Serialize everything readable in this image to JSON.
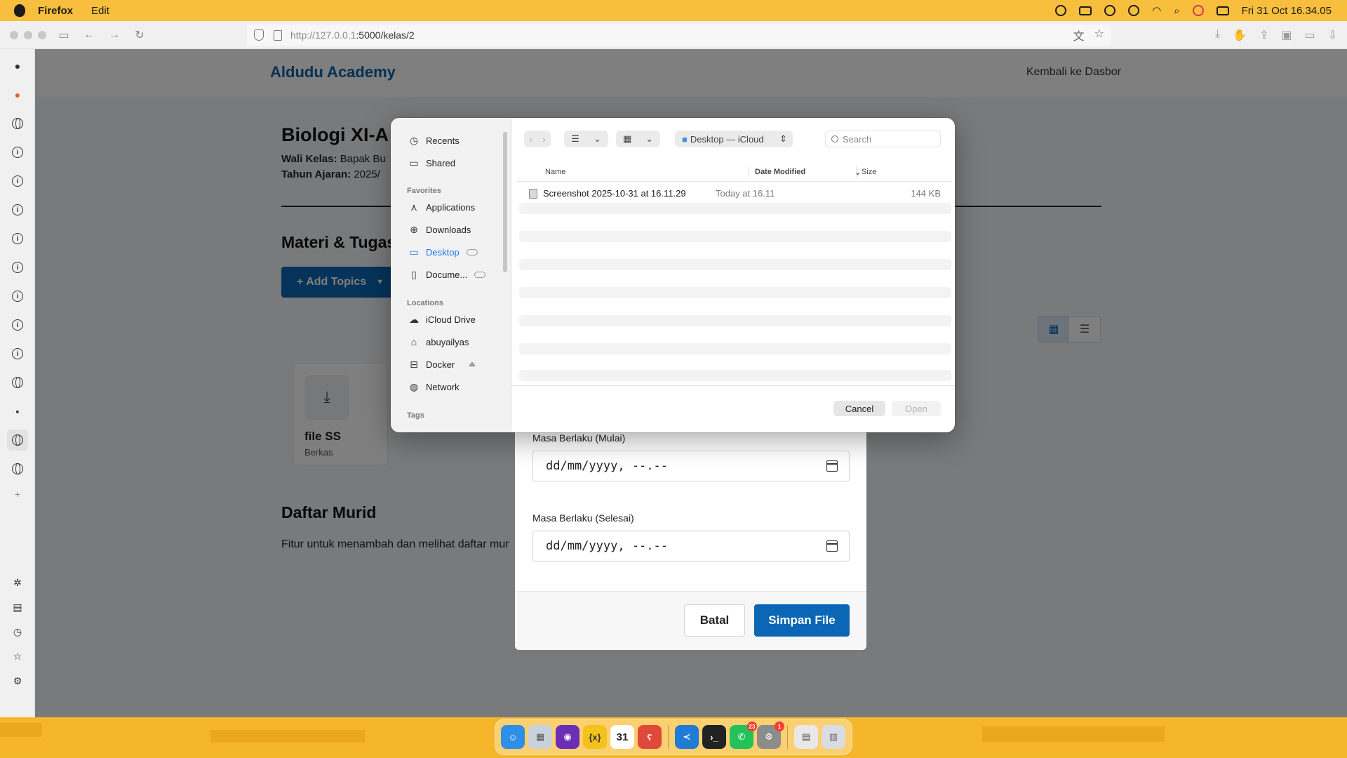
{
  "menubar": {
    "app_name": "Firefox",
    "menu_items": [
      "Edit"
    ],
    "datetime": "Fri 31 Oct  16.34.05"
  },
  "browser": {
    "url_host": "http://127.0.0.1",
    "url_path": ":5000/kelas/2"
  },
  "site": {
    "brand": "Aldudu Academy",
    "back_link": "Kembali ke Dasbor"
  },
  "course": {
    "title": "Biologi XI-A",
    "wali_label": "Wali Kelas:",
    "wali_value": "Bapak Bu",
    "tahun_label": "Tahun Ajaran:",
    "tahun_value": "2025/",
    "materials_title": "Materi & Tugas",
    "add_topics_label": "+ Add Topics",
    "file_card_name": "file SS",
    "file_card_type": "Berkas",
    "students_title": "Daftar Murid",
    "students_text": "Fitur untuk menambah dan melihat daftar mur"
  },
  "modal": {
    "start_label": "Masa Berlaku (Mulai)",
    "start_value": "dd/mm/yyyy, --.--",
    "end_label": "Masa Berlaku (Selesai)",
    "end_value": "dd/mm/yyyy, --.--",
    "cancel_label": "Batal",
    "save_label": "Simpan File"
  },
  "picker": {
    "sidebar": {
      "recents": "Recents",
      "shared": "Shared",
      "favorites_head": "Favorites",
      "applications": "Applications",
      "downloads": "Downloads",
      "desktop": "Desktop",
      "documents": "Docume...",
      "locations_head": "Locations",
      "icloud": "iCloud Drive",
      "home": "abuyailyas",
      "docker": "Docker",
      "network": "Network",
      "tags_head": "Tags"
    },
    "location": "Desktop — iCloud",
    "search_placeholder": "Search",
    "columns": {
      "name": "Name",
      "date": "Date Modified",
      "size": "Size"
    },
    "files": [
      {
        "name": "Screenshot 2025-10-31 at 16.11.29",
        "date": "Today at 16.11",
        "size": "144 KB"
      }
    ],
    "cancel_label": "Cancel",
    "open_label": "Open"
  },
  "dock": {
    "calendar_day": "31",
    "whatsapp_badge": "23",
    "settings_badge": "1"
  }
}
